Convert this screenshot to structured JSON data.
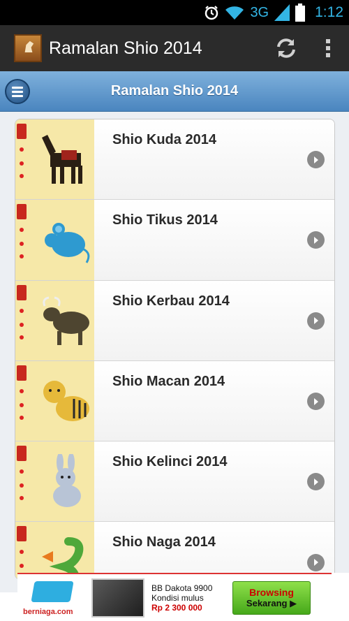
{
  "status_bar": {
    "network": "3G",
    "time": "1:12",
    "icons": [
      "alarm-icon",
      "wifi-icon",
      "signal-icon",
      "battery-icon"
    ]
  },
  "action_bar": {
    "title": "Ramalan Shio 2014",
    "icons": [
      "app-logo-icon",
      "refresh-icon",
      "overflow-menu-icon"
    ]
  },
  "sub_header": {
    "title": "Ramalan Shio 2014",
    "menu_icon": "menu-icon"
  },
  "list": {
    "items": [
      {
        "label": "Shio Kuda 2014",
        "animal": "horse-icon"
      },
      {
        "label": "Shio Tikus 2014",
        "animal": "rat-icon"
      },
      {
        "label": "Shio Kerbau 2014",
        "animal": "ox-icon"
      },
      {
        "label": "Shio Macan 2014",
        "animal": "tiger-icon"
      },
      {
        "label": "Shio Kelinci 2014",
        "animal": "rabbit-icon"
      },
      {
        "label": "Shio Naga 2014",
        "animal": "dragon-icon"
      }
    ]
  },
  "ad": {
    "brand": "berniaga.com",
    "line1": "BB Dakota 9900",
    "line2": "Kondisi mulus",
    "price": "Rp 2 300 000",
    "cta_line1": "Browsing",
    "cta_line2": "Sekarang ▶"
  },
  "colors": {
    "accent_blue": "#4a85bf",
    "status_blue": "#33b5e5",
    "action_bar": "#2b2b2b"
  }
}
